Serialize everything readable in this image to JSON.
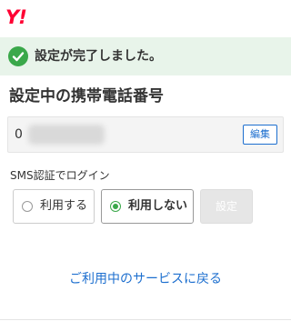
{
  "header": {
    "logo_text": "Y!"
  },
  "banner": {
    "icon": "check-circle-icon",
    "message": "設定が完了しました。",
    "color": "#3aa84a"
  },
  "phone_section": {
    "title": "設定中の携帯電話番号",
    "visible_number": "0",
    "edit_label": "編集"
  },
  "sms_login": {
    "label": "SMS認証でログイン",
    "options": [
      {
        "label": "利用する",
        "selected": false
      },
      {
        "label": "利用しない",
        "selected": true
      }
    ],
    "submit_label": "設定"
  },
  "footer": {
    "return_link": "ご利用中のサービスに戻る"
  },
  "colors": {
    "brand": "#ff0033",
    "link": "#1d6fcf",
    "success": "#3aa84a"
  }
}
